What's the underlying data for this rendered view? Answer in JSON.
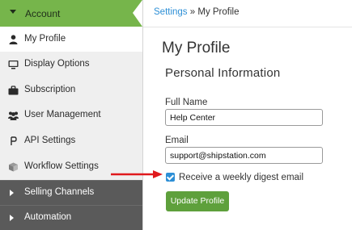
{
  "sidebar": {
    "account_label": "Account",
    "items": [
      {
        "label": "My Profile",
        "icon": "user-icon"
      },
      {
        "label": "Display Options",
        "icon": "monitor-icon"
      },
      {
        "label": "Subscription",
        "icon": "briefcase-icon"
      },
      {
        "label": "User Management",
        "icon": "users-icon"
      },
      {
        "label": "API Settings",
        "icon": "api-icon"
      },
      {
        "label": "Workflow Settings",
        "icon": "box-icon"
      }
    ],
    "collapsed_sections": [
      {
        "label": "Selling Channels"
      },
      {
        "label": "Automation"
      }
    ]
  },
  "breadcrumb": {
    "parent": "Settings",
    "separator": " » ",
    "current": "My Profile"
  },
  "main": {
    "page_title": "My Profile",
    "section_title": "Personal Information",
    "full_name": {
      "label": "Full Name",
      "value": "Help Center"
    },
    "email": {
      "label": "Email",
      "value": "support@shipstation.com"
    },
    "digest": {
      "label": "Receive a weekly digest email",
      "checked": true
    },
    "update_button": "Update Profile"
  },
  "colors": {
    "account_green": "#76b54b",
    "button_green": "#5ea03c",
    "link_blue": "#2d8fd6",
    "sidebar_dark": "#5a5a5a",
    "annotation_arrow": "#e0191d"
  }
}
